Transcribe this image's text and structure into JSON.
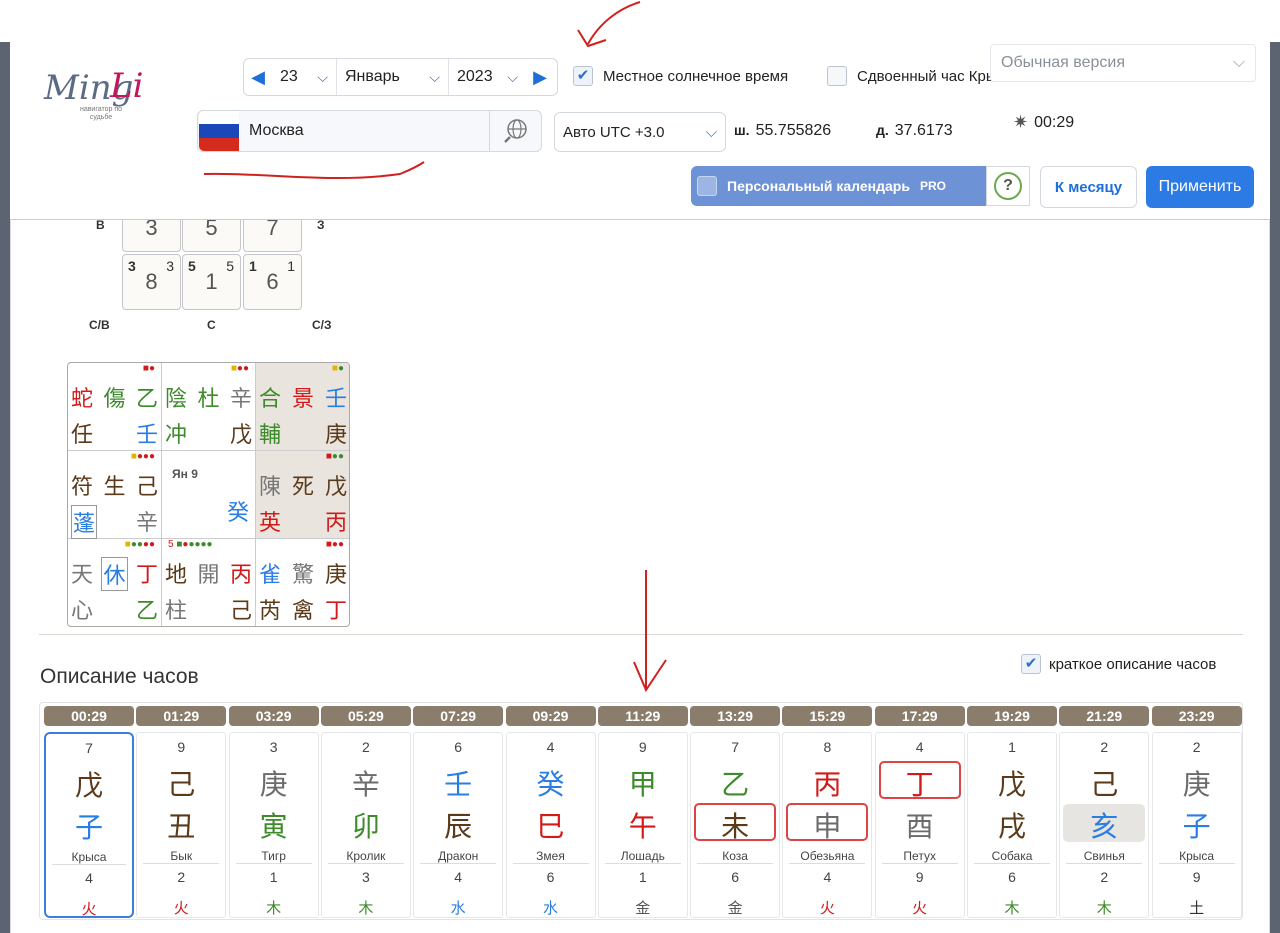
{
  "header": {
    "logo": {
      "brand_left": "Ming",
      "brand_right": "Li",
      "tagline": "навигатор по судьбе"
    },
    "date": {
      "day": "23",
      "month": "Январь",
      "year": "2023"
    },
    "solar_time": {
      "label": "Местное солнечное время",
      "checked": true
    },
    "double_rat": {
      "label": "Сдвоенный час Крысы",
      "checked": false
    },
    "version": {
      "value": "Обычная версия"
    },
    "city": {
      "name": "Москва"
    },
    "utc": {
      "value": "Авто UTC +3.0"
    },
    "lat": {
      "label": "ш.",
      "value": "55.755826"
    },
    "lon": {
      "label": "д.",
      "value": "37.6173"
    },
    "time": {
      "value": "00:29"
    },
    "personal_calendar": {
      "label": "Персональный календарь",
      "badge": "PRO"
    },
    "help": {
      "label": "?"
    },
    "to_month": {
      "label": "К месяцу"
    },
    "apply": {
      "label": "Применить"
    }
  },
  "flying_stars": {
    "labels": {
      "w": "В",
      "e": "З",
      "sw": "С/В",
      "s": "С",
      "se": "С/З"
    },
    "top_row": [
      "3",
      "5",
      "7"
    ],
    "bottom_row": [
      {
        "tl": "3",
        "big": "8",
        "tr": "3"
      },
      {
        "tl": "5",
        "big": "1",
        "tr": "5"
      },
      {
        "tl": "1",
        "big": "6",
        "tr": "1"
      }
    ]
  },
  "qimen": {
    "center_label": "Ян 9",
    "center_glyph": "癸",
    "cells": [
      {
        "r1": [
          "蛇",
          "傷",
          "乙"
        ],
        "r2": [
          "任",
          "",
          "壬"
        ]
      },
      {
        "r1": [
          "陰",
          "杜",
          "辛"
        ],
        "r2": [
          "冲",
          "",
          "戊"
        ]
      },
      {
        "r1": [
          "合",
          "景",
          "壬"
        ],
        "r2": [
          "輔",
          "",
          "庚"
        ]
      },
      {
        "r1": [
          "符",
          "生",
          "己"
        ],
        "r2": [
          "蓬",
          "",
          "辛"
        ]
      },
      {
        "r1": [
          "陳",
          "死",
          "戊"
        ],
        "r2": [
          "英",
          "",
          "丙"
        ]
      },
      {
        "r1": [
          "天",
          "休",
          "丁"
        ],
        "r2": [
          "心",
          "",
          "乙"
        ]
      },
      {
        "r1": [
          "地",
          "開",
          "丙"
        ],
        "r2": [
          "柱",
          "",
          "己"
        ]
      },
      {
        "r1": [
          "雀",
          "驚",
          "庚"
        ],
        "r2": [
          "芮",
          "禽",
          "丁"
        ]
      }
    ],
    "bottom_middle_num": "5"
  },
  "section": {
    "title": "Описание часов",
    "short_desc": {
      "label": "краткое описание часов",
      "checked": true
    }
  },
  "hours": [
    {
      "time": "00:29",
      "n1": "7",
      "stem": "戊",
      "branch": "子",
      "animal": "Крыса",
      "n2": "4",
      "elem": "火"
    },
    {
      "time": "01:29",
      "n1": "9",
      "stem": "己",
      "branch": "丑",
      "animal": "Бык",
      "n2": "2",
      "elem": "火"
    },
    {
      "time": "03:29",
      "n1": "3",
      "stem": "庚",
      "branch": "寅",
      "animal": "Тигр",
      "n2": "1",
      "elem": "木"
    },
    {
      "time": "05:29",
      "n1": "2",
      "stem": "辛",
      "branch": "卯",
      "animal": "Кролик",
      "n2": "3",
      "elem": "木"
    },
    {
      "time": "07:29",
      "n1": "6",
      "stem": "壬",
      "branch": "辰",
      "animal": "Дракон",
      "n2": "4",
      "elem": "水"
    },
    {
      "time": "09:29",
      "n1": "4",
      "stem": "癸",
      "branch": "巳",
      "animal": "Змея",
      "n2": "6",
      "elem": "水"
    },
    {
      "time": "11:29",
      "n1": "9",
      "stem": "甲",
      "branch": "午",
      "animal": "Лошадь",
      "n2": "1",
      "elem": "金"
    },
    {
      "time": "13:29",
      "n1": "7",
      "stem": "乙",
      "branch": "未",
      "animal": "Коза",
      "n2": "6",
      "elem": "金"
    },
    {
      "time": "15:29",
      "n1": "8",
      "stem": "丙",
      "branch": "申",
      "animal": "Обезьяна",
      "n2": "4",
      "elem": "火"
    },
    {
      "time": "17:29",
      "n1": "4",
      "stem": "丁",
      "branch": "酉",
      "animal": "Петух",
      "n2": "9",
      "elem": "火"
    },
    {
      "time": "19:29",
      "n1": "1",
      "stem": "戊",
      "branch": "戌",
      "animal": "Собака",
      "n2": "6",
      "elem": "木"
    },
    {
      "time": "21:29",
      "n1": "2",
      "stem": "己",
      "branch": "亥",
      "animal": "Свинья",
      "n2": "2",
      "elem": "木"
    },
    {
      "time": "23:29",
      "n1": "2",
      "stem": "庚",
      "branch": "子",
      "animal": "Крыса",
      "n2": "9",
      "elem": "土"
    }
  ]
}
